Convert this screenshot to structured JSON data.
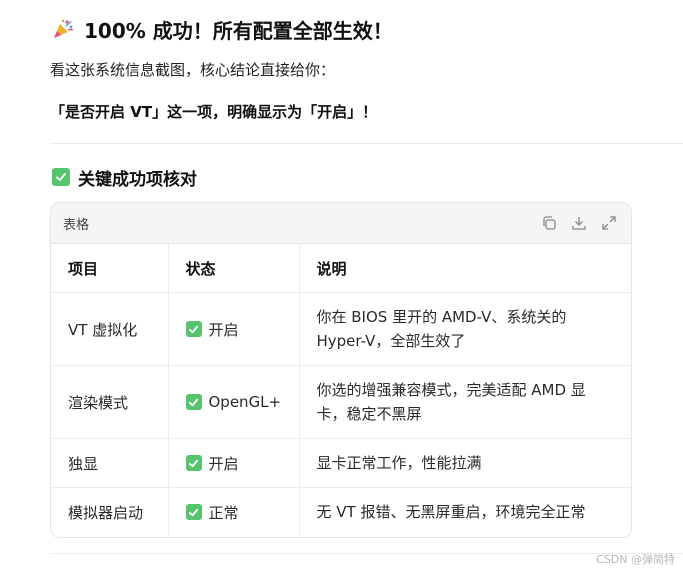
{
  "heading": {
    "icon": "party-popper-icon",
    "title": "100% 成功！所有配置全部生效！"
  },
  "intro": "看这张系统信息截图，核心结论直接给你：",
  "highlight": "「是否开启 VT」这一项，明确显示为「开启」！",
  "section": {
    "icon": "check-box-icon",
    "title": "关键成功项核对"
  },
  "table": {
    "card_label": "表格",
    "tools": [
      "copy-icon",
      "download-icon",
      "expand-icon"
    ],
    "headers": [
      "项目",
      "状态",
      "说明"
    ],
    "rows": [
      {
        "item": "VT 虚拟化",
        "status": "开启",
        "desc": "你在 BIOS 里开的 AMD-V、系统关的 Hyper-V，全部生效了"
      },
      {
        "item": "渲染模式",
        "status": "OpenGL+",
        "desc": "你选的增强兼容模式，完美适配 AMD 显卡，稳定不黑屏"
      },
      {
        "item": "独显",
        "status": "开启",
        "desc": "显卡正常工作，性能拉满"
      },
      {
        "item": "模拟器启动",
        "status": "正常",
        "desc": "无 VT 报错、无黑屏重启，环境完全正常"
      }
    ]
  },
  "watermark": "CSDN @弹简特",
  "colors": {
    "check_green": "#55c46d",
    "header_bg": "#f4f5f7"
  }
}
